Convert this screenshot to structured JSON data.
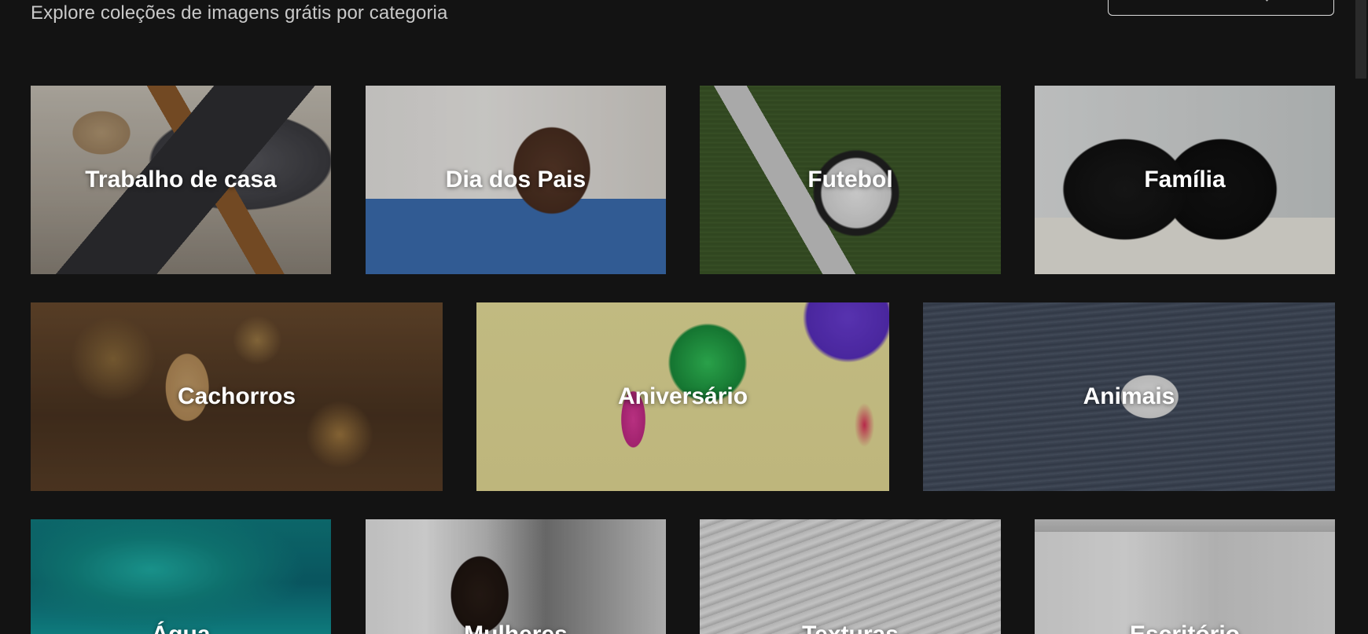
{
  "header": {
    "subtitle": "Explore coleções de imagens grátis por categoria"
  },
  "categories": [
    {
      "label": "Trabalho de casa"
    },
    {
      "label": "Dia dos Pais"
    },
    {
      "label": "Futebol"
    },
    {
      "label": "Família"
    },
    {
      "label": "Cachorros"
    },
    {
      "label": "Aniversário"
    },
    {
      "label": "Animais"
    },
    {
      "label": "Água"
    },
    {
      "label": "Mulheres"
    },
    {
      "label": "Texturas"
    },
    {
      "label": "Escritório"
    }
  ]
}
